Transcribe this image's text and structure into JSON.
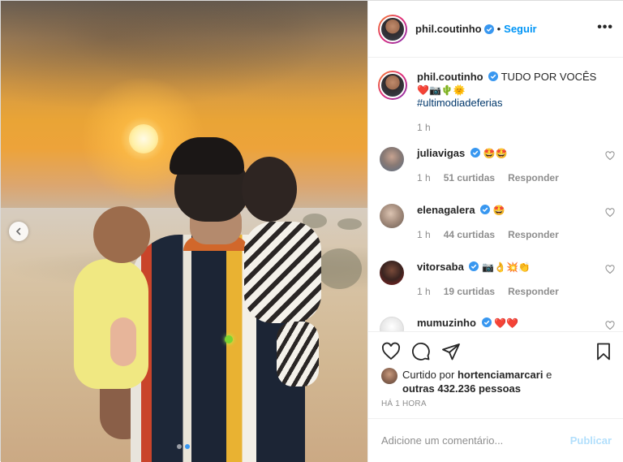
{
  "post": {
    "username": "phil.coutinho",
    "separator": "•",
    "follow_label": "Seguir",
    "more_label": "•••",
    "caption_text": "TUDO POR VOCÊS",
    "caption_emojis": "❤️📷🌵🌞",
    "hashtag": "#ultimodiadeferias",
    "caption_time": "1 h"
  },
  "comments": [
    {
      "username": "juliavigas",
      "verified": true,
      "text": "🤩🤩",
      "time": "1 h",
      "likes": "51 curtidas",
      "reply": "Responder"
    },
    {
      "username": "elenagalera",
      "verified": true,
      "text": "🤩",
      "time": "1 h",
      "likes": "44 curtidas",
      "reply": "Responder"
    },
    {
      "username": "vitorsaba",
      "verified": true,
      "text": "📷👌💥👏",
      "time": "1 h",
      "likes": "19 curtidas",
      "reply": "Responder"
    },
    {
      "username": "mumuzinho",
      "verified": true,
      "text": "❤️❤️",
      "time": "",
      "likes": "",
      "reply": ""
    }
  ],
  "likes": {
    "prefix": "Curtido por",
    "user": "hortenciamarcari",
    "connector": "e",
    "others": "outras 432.236 pessoas"
  },
  "time_ago": "HÁ 1 HORA",
  "comment_box": {
    "placeholder": "Adicione um comentário...",
    "publish_label": "Publicar"
  },
  "carousel": {
    "slide": 2,
    "total": 2
  },
  "colors": {
    "link": "#0095f6",
    "verified": "#3897f0",
    "publish_disabled": "#b2dffc",
    "muted": "#8e8e8e"
  }
}
